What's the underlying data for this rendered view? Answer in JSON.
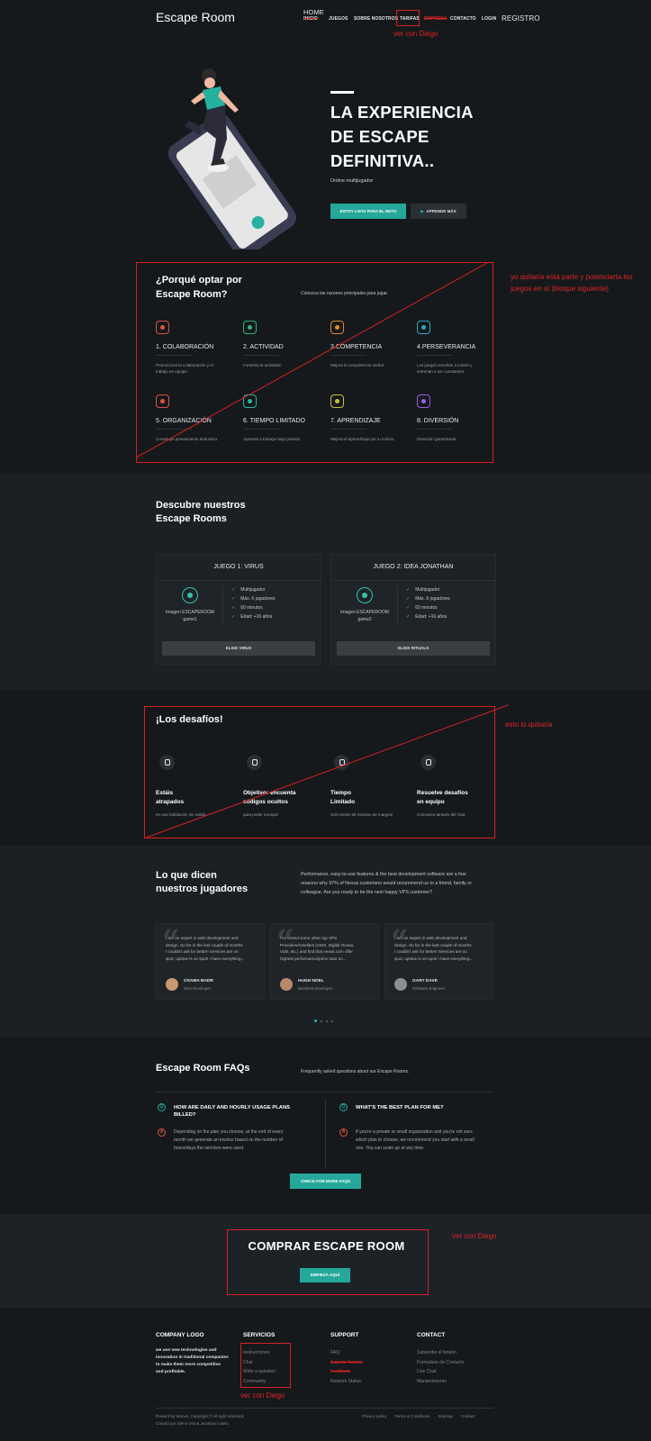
{
  "nav": {
    "brand": "Escape Room",
    "home_struck": "INICIO",
    "home_note": "HOME",
    "items": [
      "JUEGOS",
      "SOBRE NOSOTROS",
      "TARIFAS",
      "EMPRESA",
      "CONTACTO",
      "LOGIN"
    ],
    "register_note": "REGISTRO",
    "tarifas_note": "ver con Diego"
  },
  "hero": {
    "title_l1": "LA EXPERIENCIA",
    "title_l2": "DE ESCAPE",
    "title_l3": "DEFINITIVA..",
    "subtitle": "Online multijugador",
    "btn_primary": "ESTOY LISTA PARA EL RETO",
    "btn_secondary": "APRENDE MÁS"
  },
  "why": {
    "title_l1": "¿Porqué optar por",
    "title_l2": "Escape Room?",
    "intro": "Conozca las razones principales para jugar.",
    "note": "yo quitaría esta parte y potenciaría los juegos en sí (bloque siguiente)",
    "features": [
      {
        "title": "1. COLABORACIÓN",
        "desc_l1": "Promociona la colaboración y el",
        "desc_l2": "trabajo en equipo.",
        "icon": "collaboration-icon",
        "color": "#e0523e"
      },
      {
        "title": "2. ACTIVIDAD",
        "desc_l1": "Fomenta la actividad.",
        "desc_l2": "",
        "icon": "activity-icon",
        "color": "#2fb37a"
      },
      {
        "title": "3.COMPETENCIA",
        "desc_l1": "Mejora la competencia verbal.",
        "desc_l2": "",
        "icon": "competition-icon",
        "color": "#e08a2b"
      },
      {
        "title": "4.PERSEVERANCIA",
        "desc_l1": "Los juegos enseñan a insistir y",
        "desc_l2": "entrenan a ser constantes.",
        "icon": "perseverance-icon",
        "color": "#2fa6c0"
      },
      {
        "title": "5. ORGANIZACIÓN",
        "desc_l1": "Construye pensamiento deductivo.",
        "desc_l2": "",
        "icon": "organization-icon",
        "color": "#e0523e"
      },
      {
        "title": "6. TIEMPO LIMITADO",
        "desc_l1": "Aprenda a trabajar bajo presión.",
        "desc_l2": "",
        "icon": "time-icon",
        "color": "#2fb3a5"
      },
      {
        "title": "7. APRENDIZAJE",
        "desc_l1": "Mejora el aprendizaje por tu mismo.",
        "desc_l2": "",
        "icon": "learning-icon",
        "color": "#c8c235"
      },
      {
        "title": "8. DIVERSIÓN",
        "desc_l1": "Diversión garantizada.",
        "desc_l2": "",
        "icon": "fun-icon",
        "color": "#9b5de5"
      }
    ]
  },
  "games": {
    "title_l1": "Descubre nuestros",
    "title_l2": "Escape Rooms",
    "cards": [
      {
        "header": "JUEGO 1: VIRUS",
        "img_l1": "Imagen ESCAPEROOM",
        "img_l2": "game1",
        "specs": [
          "Multijugador",
          "Máx. 6 jugadores",
          "60 minutos",
          "Edad: +16 años"
        ],
        "button": "ELIGE VIRUS"
      },
      {
        "header": "JUEGO 2: IDEA JONATHAN",
        "img_l1": "Imagen ESCAPEROOM",
        "img_l2": "game2",
        "specs": [
          "Multijugador",
          "Máx. 6 jugadores",
          "60 minutos",
          "Edad: +16 años"
        ],
        "button": "ELIGE RITUALS"
      }
    ]
  },
  "challenges": {
    "title": "¡Los desafíos!",
    "note": "esto lo quitaría",
    "items": [
      {
        "title_l1": "Estáis",
        "title_l2": "atrapados",
        "desc": "en una habitación sin salida.",
        "icon": "rocket-icon"
      },
      {
        "title_l1": "Objetivo: encuenta",
        "title_l2": "códigos ocultos",
        "desc": "para poder escapar",
        "icon": "support-icon"
      },
      {
        "title_l1": "Tiempo",
        "title_l2": "Limitado",
        "desc": "Solo tenéis 60 minutos de margen!",
        "icon": "shield-icon"
      },
      {
        "title_l1": "Resuelve desafíos",
        "title_l2": "en equipo",
        "desc": "Comunica através del chat.",
        "icon": "team-icon"
      }
    ]
  },
  "testimonials": {
    "title_l1": "Lo que dicen",
    "title_l2": "nuestros jugadores",
    "intro_l1": "Performance, easy-to-use features & the best development software are a few",
    "intro_l2": "reasons why 97% of Nexus customers would recommend us to a friend, family or",
    "intro_l3": "colleague. Are you ready to be the next happy VPS customer?",
    "items": [
      {
        "text_l1": "I am an expert in web development and",
        "text_l2": "design. So far in the last couple of months",
        "text_l3": "I couldn't ask for better! Services are on",
        "text_l4": "spot, uptime is on spot! I have everything...",
        "name": "OSAMA BADR",
        "role": "Web Developer",
        "avatar_color": "#c79a72"
      },
      {
        "text_l1": "I've tested some other top VPS",
        "text_l2": "Providers/resellers (AWS, Digital Ocean,",
        "text_l3": "Vultr, etc.) and find that nexus.com offer",
        "text_l4": "highest performance/price ratio on...",
        "name": "HUGH NOEL",
        "role": "Backend Developer",
        "avatar_color": "#b9876a"
      },
      {
        "text_l1": "I am an expert in web development and",
        "text_l2": "design. So far in the last couple of months",
        "text_l3": "I couldn't ask for better! Services are on",
        "text_l4": "spot, uptime is on spot! I have everything...",
        "name": "GARY DAVE",
        "role": "Software Engineer",
        "avatar_color": "#8a8f96"
      }
    ]
  },
  "faq": {
    "title": "Escape Room FAQs",
    "intro": "Frequently asked questions about our Escape Rooms.",
    "items": [
      {
        "q_l1": "HOW ARE DAILY AND HOURLY USAGE PLANS",
        "q_l2": "BILLED?",
        "a_l1": "Depending on the plan you choose, at the end of every",
        "a_l2": "month we generate an invoice based on the number of",
        "a_l3": "hours/days the services were used."
      },
      {
        "q_l1": "WHAT'S THE BEST PLAN FOR ME?",
        "q_l2": "",
        "a_l1": "If you're a private or small organization and you're not sure",
        "a_l2": "which plan to choose, we recommend you start with a small",
        "a_l3": "one. You can scale up at any time."
      }
    ],
    "q_badge": "Q",
    "a_badge": "A",
    "button": "CHECK FOR MORE FAQS"
  },
  "cta": {
    "title": "COMPRAR ESCAPE ROOM",
    "button": "EMPIEZA AQUÍ",
    "note": "ver con Diego"
  },
  "footer": {
    "company": {
      "title": "COMPANY LOGO",
      "text_l1": "we use new technologies and",
      "text_l2": "innovation in traditional companies",
      "text_l3": "to make them more competitive",
      "text_l4": "and profitable."
    },
    "services": {
      "title": "SERVICIOS",
      "items": [
        "Instrucciones",
        "Chat",
        "Write a question",
        "Community"
      ],
      "note": "ver con Diego"
    },
    "support": {
      "title": "SUPPORT",
      "items": [
        "FAQ",
        "Soporte Tecnico",
        "Feedback",
        "Network Status"
      ]
    },
    "contact": {
      "title": "CONTACT",
      "items": [
        "Subscribe al boletín",
        "Formulario de Contacto",
        "Live Chat",
        "Mantenimiento"
      ]
    },
    "copyright_l1": "Powerd by Marvel, Copyright © All right reserved.",
    "copyright_l2": "Creado por Elena Vila & Jonathan Uaelo",
    "bottom_links": [
      "Privacy policy",
      "Terms & Conditions",
      "Sitemap",
      "Contact"
    ]
  }
}
